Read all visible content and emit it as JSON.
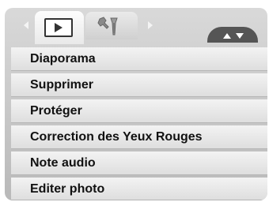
{
  "tabs": [
    {
      "icon": "play-icon",
      "selected": true
    },
    {
      "icon": "tools-icon",
      "selected": false
    }
  ],
  "scroll_indicator": {
    "icons": [
      "up-arrow-icon",
      "down-arrow-icon"
    ]
  },
  "menu": {
    "items": [
      {
        "label": "Diaporama"
      },
      {
        "label": "Supprimer"
      },
      {
        "label": "Protéger"
      },
      {
        "label": "Correction des Yeux Rouges"
      },
      {
        "label": "Note audio"
      },
      {
        "label": "Editer photo"
      }
    ]
  },
  "colors": {
    "frame": "#c8c8c8",
    "menu_item": "#e8e8e8",
    "scroll_tab": "#555555",
    "text": "#111111"
  }
}
